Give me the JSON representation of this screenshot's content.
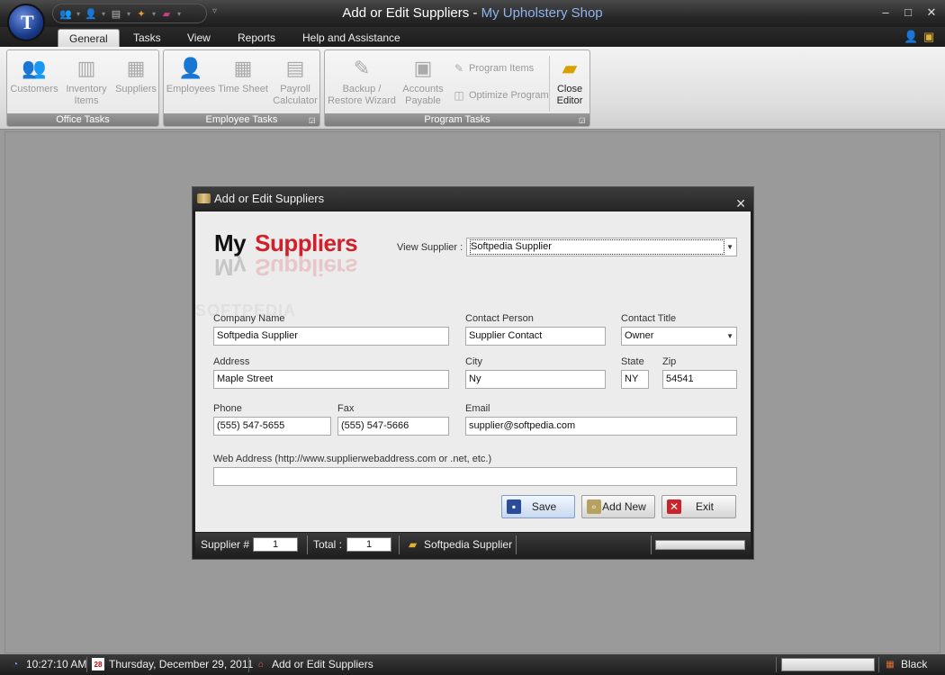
{
  "window": {
    "title_main": "Add or Edit Suppliers - ",
    "title_app": "My Upholstery Shop",
    "minimize": "–",
    "maximize": "□",
    "close": "✕"
  },
  "quick_access_icons": [
    "users-icon",
    "user-icon",
    "document-icon",
    "wand-icon",
    "book-icon"
  ],
  "ribbon": {
    "tabs": [
      {
        "label": "General",
        "active": true
      },
      {
        "label": "Tasks",
        "active": false
      },
      {
        "label": "View",
        "active": false
      },
      {
        "label": "Reports",
        "active": false
      },
      {
        "label": "Help and Assistance",
        "active": false
      }
    ],
    "groups": {
      "office": {
        "label": "Office Tasks",
        "buttons": {
          "customers": "Customers",
          "inventory": "Inventory Items",
          "suppliers": "Suppliers"
        }
      },
      "employee": {
        "label": "Employee Tasks",
        "buttons": {
          "employees": "Employees",
          "timesheet": "Time Sheet",
          "payroll": "Payroll Calculator"
        }
      },
      "program": {
        "label": "Program Tasks",
        "buttons": {
          "backup": "Backup / Restore Wizard",
          "accounts": "Accounts Payable",
          "program_items": "Program Items",
          "optimize": "Optimize Program",
          "close_editor": "Close Editor"
        }
      }
    }
  },
  "dialog": {
    "title": "Add or Edit Suppliers",
    "heading_word1": "My",
    "heading_word2": "Suppliers",
    "watermark": "SOFTPEDIA",
    "view_supplier_label": "View Supplier :",
    "view_supplier_value": "Softpedia Supplier",
    "fields": {
      "company_name": {
        "label": "Company Name",
        "value": "Softpedia Supplier"
      },
      "contact_person": {
        "label": "Contact Person",
        "value": "Supplier Contact"
      },
      "contact_title": {
        "label": "Contact Title",
        "value": "Owner"
      },
      "address": {
        "label": "Address",
        "value": "Maple Street"
      },
      "city": {
        "label": "City",
        "value": "Ny"
      },
      "state": {
        "label": "State",
        "value": "NY"
      },
      "zip": {
        "label": "Zip",
        "value": "54541"
      },
      "phone": {
        "label": "Phone",
        "value": "(555) 547-5655"
      },
      "fax": {
        "label": "Fax",
        "value": "(555) 547-5666"
      },
      "email": {
        "label": "Email",
        "value": "supplier@softpedia.com"
      },
      "web": {
        "label": "Web Address (http://www.supplierwebaddress.com or .net, etc.)",
        "value": ""
      }
    },
    "buttons": {
      "save": "Save",
      "add_new": "Add New",
      "exit": "Exit"
    },
    "status": {
      "supplier_label": "Supplier #",
      "supplier_value": "1",
      "total_label": "Total :",
      "total_value": "1",
      "current": "Softpedia Supplier"
    }
  },
  "statusbar": {
    "time": "10:27:10 AM",
    "calendar_day": "28",
    "date": "Thursday, December 29, 2011",
    "current_form": "Add or Edit Suppliers",
    "theme": "Black"
  }
}
